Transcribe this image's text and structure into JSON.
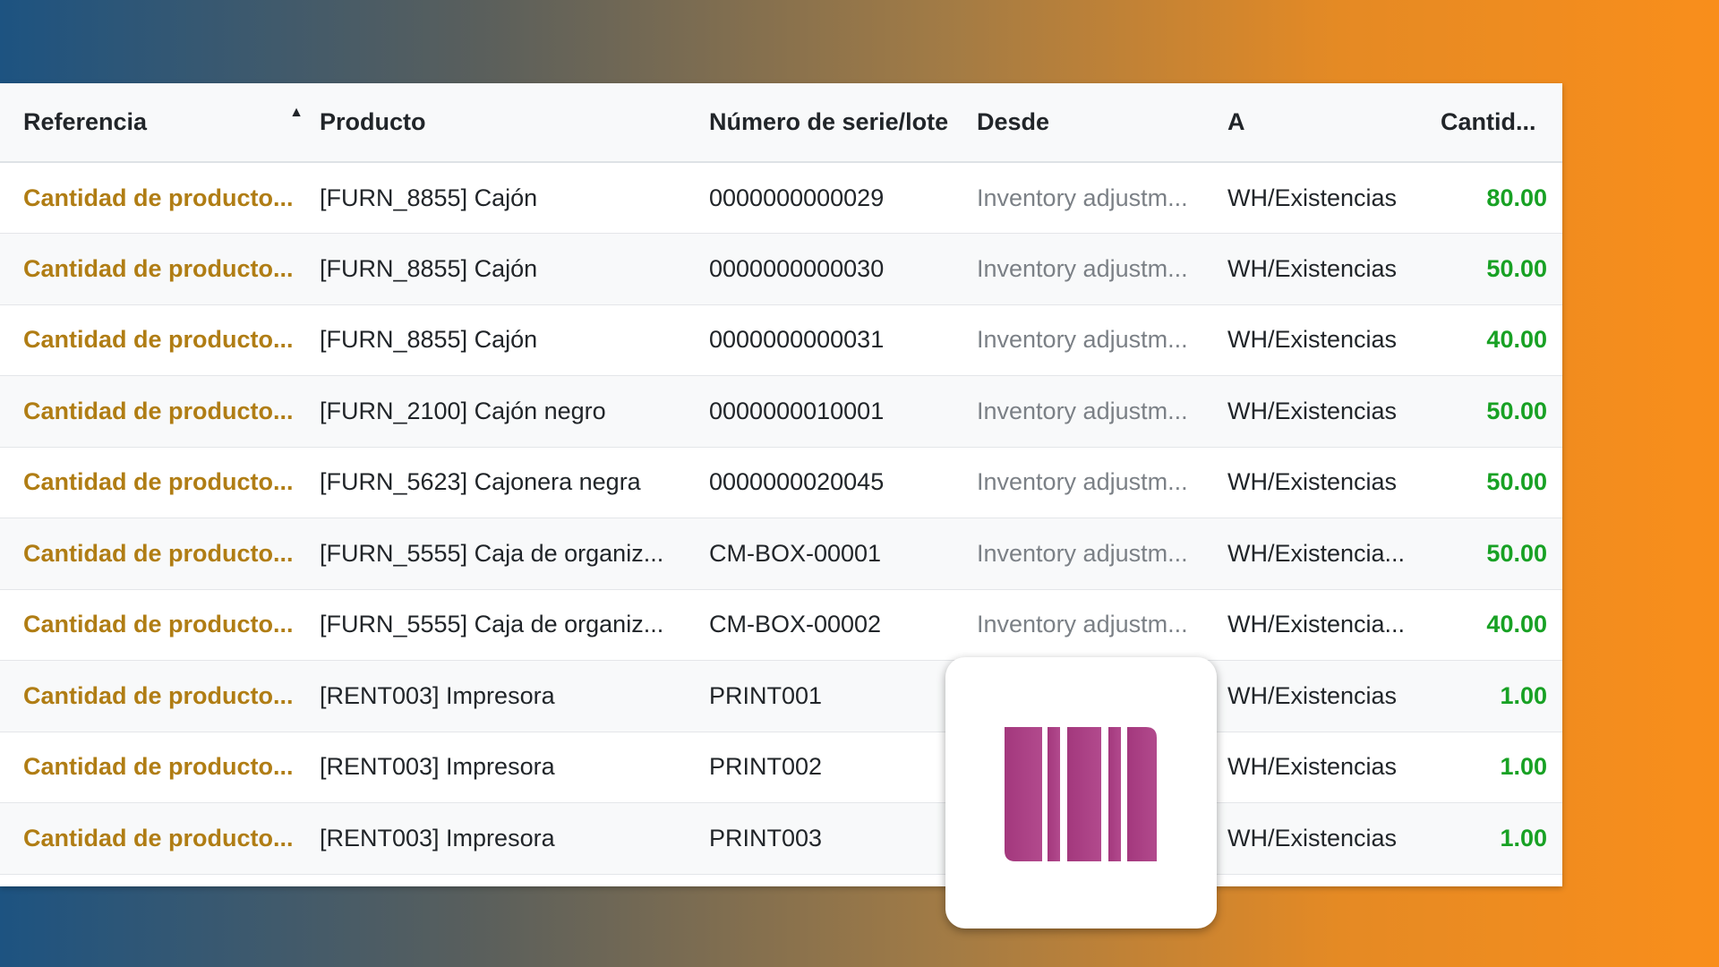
{
  "table": {
    "columns": [
      {
        "key": "ref",
        "label": "Referencia",
        "sorted": "ascending"
      },
      {
        "key": "product",
        "label": "Producto"
      },
      {
        "key": "lot",
        "label": "Número de serie/lote"
      },
      {
        "key": "from",
        "label": "Desde"
      },
      {
        "key": "to",
        "label": "A"
      },
      {
        "key": "qty",
        "label": "Cantid..."
      }
    ],
    "rows": [
      {
        "ref": "Cantidad de producto...",
        "product": "[FURN_8855] Cajón",
        "lot": "0000000000029",
        "from": "Inventory adjustm...",
        "to": "WH/Existencias",
        "qty": "80.00"
      },
      {
        "ref": "Cantidad de producto...",
        "product": "[FURN_8855] Cajón",
        "lot": "0000000000030",
        "from": "Inventory adjustm...",
        "to": "WH/Existencias",
        "qty": "50.00"
      },
      {
        "ref": "Cantidad de producto...",
        "product": "[FURN_8855] Cajón",
        "lot": "0000000000031",
        "from": "Inventory adjustm...",
        "to": "WH/Existencias",
        "qty": "40.00"
      },
      {
        "ref": "Cantidad de producto...",
        "product": "[FURN_2100] Cajón negro",
        "lot": "0000000010001",
        "from": "Inventory adjustm...",
        "to": "WH/Existencias",
        "qty": "50.00"
      },
      {
        "ref": "Cantidad de producto...",
        "product": "[FURN_5623] Cajonera negra",
        "lot": "0000000020045",
        "from": "Inventory adjustm...",
        "to": "WH/Existencias",
        "qty": "50.00"
      },
      {
        "ref": "Cantidad de producto...",
        "product": "[FURN_5555] Caja de organiz...",
        "lot": "CM-BOX-00001",
        "from": "Inventory adjustm...",
        "to": "WH/Existencia...",
        "qty": "50.00"
      },
      {
        "ref": "Cantidad de producto...",
        "product": "[FURN_5555] Caja de organiz...",
        "lot": "CM-BOX-00002",
        "from": "Inventory adjustm...",
        "to": "WH/Existencia...",
        "qty": "40.00"
      },
      {
        "ref": "Cantidad de producto...",
        "product": "[RENT003] Impresora",
        "lot": "PRINT001",
        "from": "",
        "to": "WH/Existencias",
        "qty": "1.00"
      },
      {
        "ref": "Cantidad de producto...",
        "product": "[RENT003] Impresora",
        "lot": "PRINT002",
        "from": "",
        "to": "WH/Existencias",
        "qty": "1.00"
      },
      {
        "ref": "Cantidad de producto...",
        "product": "[RENT003] Impresora",
        "lot": "PRINT003",
        "from": "",
        "to": "WH/Existencias",
        "qty": "1.00"
      }
    ]
  },
  "badge": {
    "icon": "barcode-icon",
    "color": "#a83f82"
  },
  "colors": {
    "reference": "#b07d14",
    "quantity": "#18a124",
    "muted": "#7b8086"
  }
}
